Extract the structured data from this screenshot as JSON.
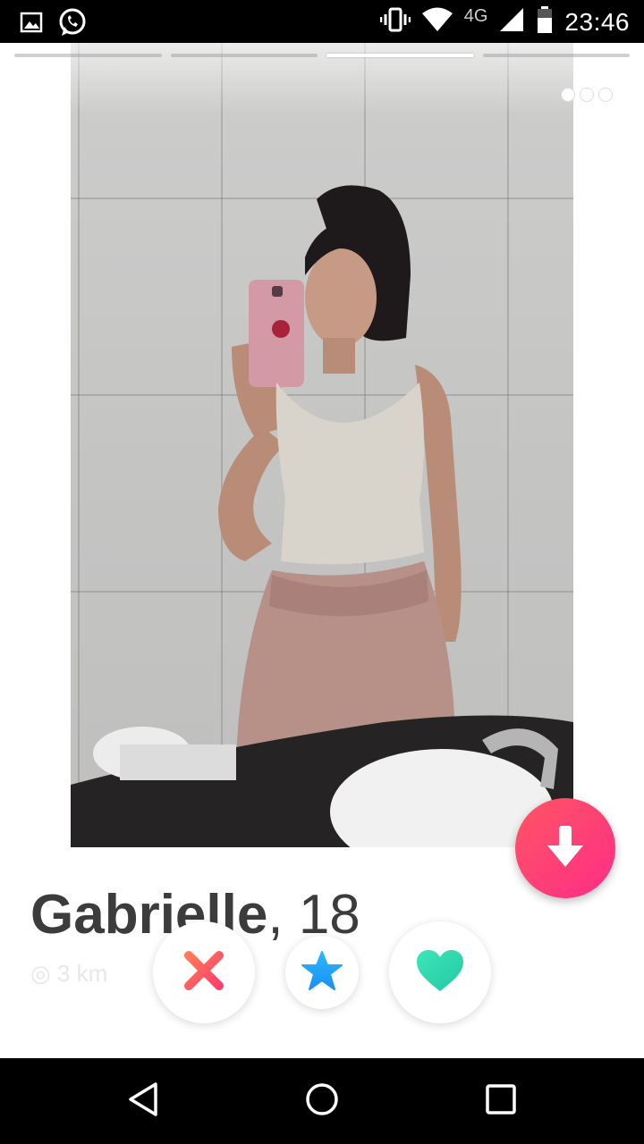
{
  "status_bar": {
    "time": "23:46",
    "network": "4G",
    "icons": [
      "image-icon",
      "whatsapp-icon",
      "vibrate-icon",
      "wifi-icon",
      "cell-signal-icon",
      "battery-icon"
    ]
  },
  "photo": {
    "tab_count": 4,
    "active_tab": 3,
    "description_icon": "more-dots-icon"
  },
  "profile": {
    "name": "Gabrielle",
    "separator": ",",
    "age": "18",
    "distance": "3 km"
  },
  "actions": {
    "nope_icon": "close-icon",
    "super_like_icon": "star-icon",
    "like_icon": "heart-icon",
    "info_icon": "arrow-down-icon"
  },
  "colors": {
    "nope": "#ff4458",
    "super_like": "#1ca4fc",
    "like": "#3ee0b0",
    "info_start": "#fd5564",
    "info_end": "#ff2d86"
  },
  "nav": {
    "back_icon": "back-icon",
    "home_icon": "home-icon",
    "recent_icon": "recents-icon"
  }
}
